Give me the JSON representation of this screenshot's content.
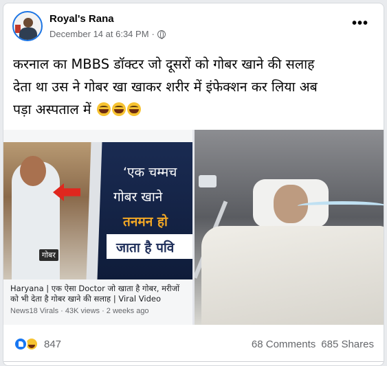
{
  "post": {
    "author": "Royal's Rana",
    "date": "December 14 at 6:34 PM",
    "separator": "·",
    "more": "•••",
    "text_line1": "करनाल का MBBS डॉक्टर जो दूसरों को गोबर खाने की सलाह",
    "text_line2": "देता था उस ने गोबर खा खाकर शरीर में इंफेक्शन कर लिया अब",
    "text_line3": "पड़ा अस्पताल में",
    "emojis": [
      "haha",
      "haha",
      "haha"
    ]
  },
  "media": {
    "left": {
      "overlay_label": "गोबर",
      "headline_1": "‘एक चम्मच",
      "headline_2": "गोबर खाने",
      "headline_3": "तनमन हो",
      "headline_4": "जाता है पवि",
      "caption": "Haryana | एक ऐसा Doctor जो खाता है गोबर, मरीजों को भी देता है गोबर खाने की सलाह | Viral Video",
      "source": "News18 Virals · 43K views · 2 weeks ago"
    },
    "right": {
      "description": "hospital-patient-photo"
    }
  },
  "footer": {
    "reaction_count": "847",
    "comments": "68 Comments",
    "shares": "685 Shares"
  },
  "colors": {
    "link_blue": "#1877f2",
    "meta_gray": "#65676b"
  }
}
